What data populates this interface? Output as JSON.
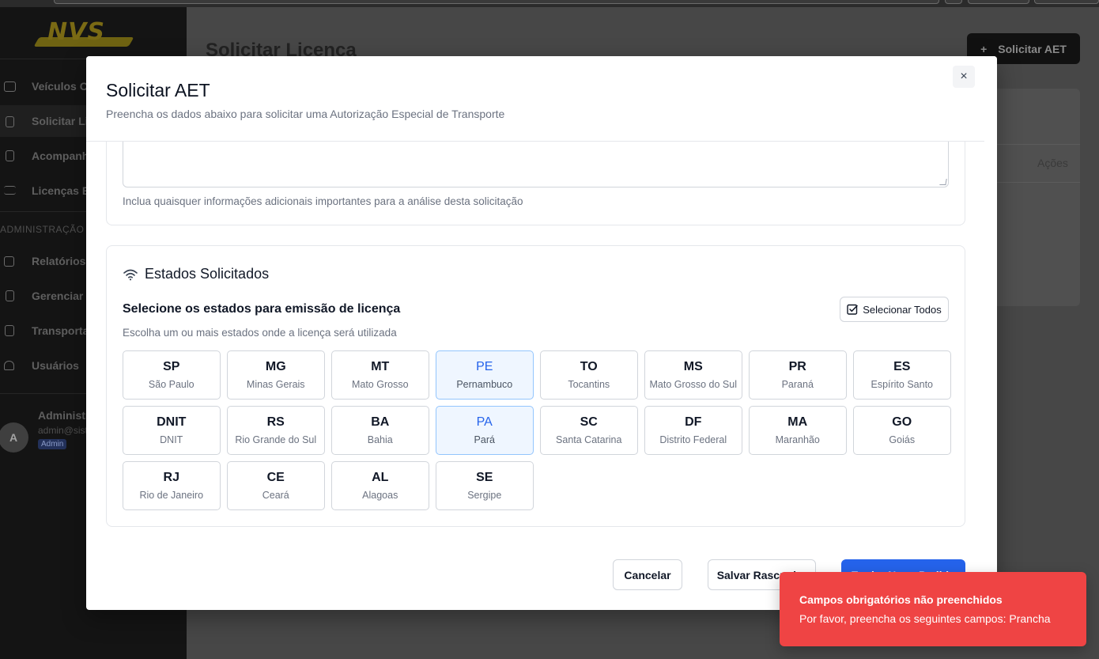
{
  "sidebar": {
    "logo_text": "NVS",
    "items": [
      {
        "label": "Veículos Ca",
        "icon": "truck-icon"
      },
      {
        "label": "Solicitar Lic",
        "icon": "file-icon"
      },
      {
        "label": "Acompanh",
        "icon": "clipboard-icon"
      },
      {
        "label": "Licenças Em",
        "icon": "list-check-icon"
      },
      {
        "label": "Relatórios",
        "icon": "grid-icon"
      },
      {
        "label": "Gerenciar L",
        "icon": "file-edit-icon"
      },
      {
        "label": "Transporta",
        "icon": "building-icon"
      },
      {
        "label": "Usuários",
        "icon": "users-icon"
      }
    ],
    "section_admin": "ADMINISTRAÇÃO",
    "user": {
      "avatar": "A",
      "name": "Administr",
      "email": "admin@sist",
      "role": "Admin"
    }
  },
  "background": {
    "page_title": "Solicitar Licença",
    "new_button": "Solicitar AET",
    "new_button_icon": "+",
    "table_actions": "Ações"
  },
  "modal": {
    "title": "Solicitar AET",
    "subtitle": "Preencha os dados abaixo para solicitar uma Autorização Especial de Transporte",
    "close_icon": "×",
    "observations_hint": "Inclua quaisquer informações adicionais importantes para a análise desta solicitação",
    "states": {
      "title": "Estados Solicitados",
      "select_label": "Selecione os estados para emissão de licença",
      "select_help": "Escolha um ou mais estados onde a licença será utilizada",
      "select_all": "Selecionar Todos",
      "items": [
        {
          "code": "SP",
          "name": "São Paulo",
          "selected": false
        },
        {
          "code": "MG",
          "name": "Minas Gerais",
          "selected": false
        },
        {
          "code": "MT",
          "name": "Mato Grosso",
          "selected": false
        },
        {
          "code": "PE",
          "name": "Pernambuco",
          "selected": true
        },
        {
          "code": "TO",
          "name": "Tocantins",
          "selected": false
        },
        {
          "code": "MS",
          "name": "Mato Grosso do Sul",
          "selected": false
        },
        {
          "code": "PR",
          "name": "Paraná",
          "selected": false
        },
        {
          "code": "ES",
          "name": "Espírito Santo",
          "selected": false
        },
        {
          "code": "DNIT",
          "name": "DNIT",
          "selected": false
        },
        {
          "code": "RS",
          "name": "Rio Grande do Sul",
          "selected": false
        },
        {
          "code": "BA",
          "name": "Bahia",
          "selected": false
        },
        {
          "code": "PA",
          "name": "Pará",
          "selected": true
        },
        {
          "code": "SC",
          "name": "Santa Catarina",
          "selected": false
        },
        {
          "code": "DF",
          "name": "Distrito Federal",
          "selected": false
        },
        {
          "code": "MA",
          "name": "Maranhão",
          "selected": false
        },
        {
          "code": "GO",
          "name": "Goiás",
          "selected": false
        },
        {
          "code": "RJ",
          "name": "Rio de Janeiro",
          "selected": false
        },
        {
          "code": "CE",
          "name": "Ceará",
          "selected": false
        },
        {
          "code": "AL",
          "name": "Alagoas",
          "selected": false
        },
        {
          "code": "SE",
          "name": "Sergipe",
          "selected": false
        }
      ]
    },
    "footer": {
      "cancel": "Cancelar",
      "save_draft": "Salvar Rascunho",
      "submit": "Enviar Novo Pedido"
    }
  },
  "toast": {
    "title": "Campos obrigatórios não preenchidos",
    "body": "Por favor, preencha os seguintes campos: Prancha"
  },
  "colors": {
    "primary": "#2563eb",
    "toast_bg": "#ef4444",
    "selected_bg": "#eff6ff"
  }
}
